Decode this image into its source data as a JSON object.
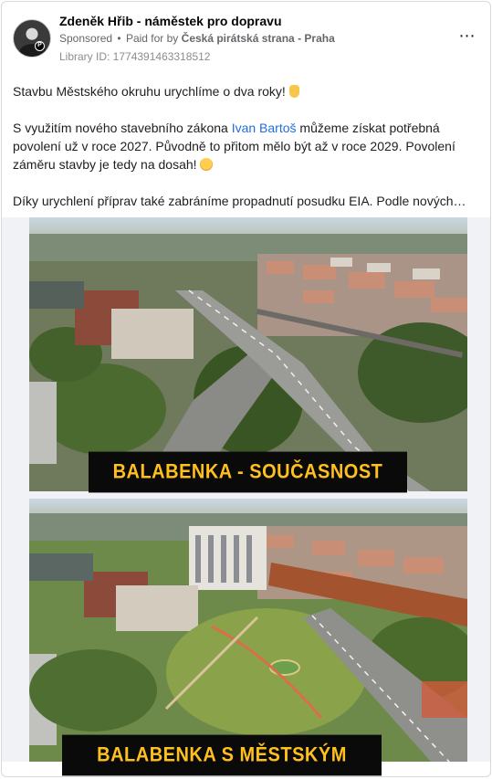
{
  "post": {
    "author": "Zdeněk Hřib - náměstek pro dopravu",
    "sponsored_label": "Sponsored",
    "separator": "•",
    "paid_for_prefix": "Paid for by",
    "paid_for_by": "Česká pirátská strana - Praha",
    "library_id": "Library ID: 1774391463318512",
    "more_icon": "⋯",
    "avatar_badge": "P"
  },
  "body": {
    "line1": "Stavbu Městského okruhu urychlíme o dva roky!",
    "para2_before_link": "S využitím nového stavebního zákona ",
    "para2_link": "Ivan Bartoš",
    "para2_after_link": " můžeme získat potřebná povolení už v roce 2027. Původně to přitom mělo být až v roce 2029. Povolení záměru stavby je tedy na dosah!",
    "para3": "Díky urychlení příprav také zabráníme propadnutí posudku EIA. Podle nových…"
  },
  "media": {
    "caption_top": "BALABENKA - SOUČASNOST",
    "caption_bottom": "BALABENKA S MĚSTSKÝM OKRUHEM"
  },
  "icons": {
    "thumb": "thumbs-up-emoji",
    "smile": "winking-emoji",
    "more": "more-options-icon"
  },
  "colors": {
    "link": "#216fdb",
    "caption_text": "#ffc01e",
    "caption_bg": "#0a0a0a",
    "meta": "#65676b"
  }
}
